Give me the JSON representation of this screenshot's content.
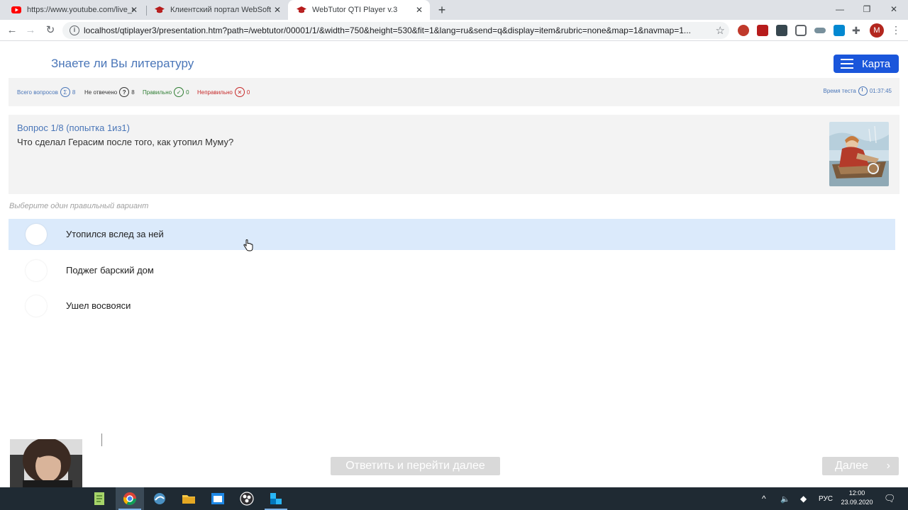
{
  "browser": {
    "tabs": [
      {
        "title": "https://www.youtube.com/live_c",
        "active": false
      },
      {
        "title": "Клиентский портал WebSoft",
        "active": false
      },
      {
        "title": "WebTutor QTI Player v.3",
        "active": true
      }
    ],
    "url": "localhost/qtiplayer3/presentation.htm?path=/webtutor/00001/1/&width=750&height=530&fit=1&lang=ru&send=q&display=item&rubric=none&map=1&navmap=1...",
    "profile_initial": "M"
  },
  "header": {
    "title": "Знаете ли Вы литературу",
    "map_button": "Карта"
  },
  "stats": {
    "total_label": "Всего вопросов",
    "total_value": "8",
    "unanswered_label": "Не отвечено",
    "unanswered_value": "8",
    "correct_label": "Правильно",
    "correct_value": "0",
    "wrong_label": "Неправильно",
    "wrong_value": "0",
    "timer_label": "Время теста",
    "timer_value": "01:37:45"
  },
  "question": {
    "header": "Вопрос 1/8  (попытка 1из1)",
    "text": "Что сделал Герасим после того, как утопил Муму?",
    "instruction": "Выберите один правильный вариант",
    "options": [
      {
        "label": "Утопился вслед за ней",
        "hovered": true
      },
      {
        "label": "Поджег барский дом",
        "hovered": false
      },
      {
        "label": "Ушел восвояси",
        "hovered": false
      }
    ]
  },
  "footer": {
    "answer_button": "Ответить и перейти далее",
    "next_button": "Далее"
  },
  "taskbar": {
    "language": "РУС",
    "time": "12:00",
    "date": "23.09.2020"
  },
  "colors": {
    "accent": "#4a76b8",
    "map_button": "#1a56db",
    "hover_row": "#dbeafb",
    "disabled_button": "#d9d9d9",
    "correct": "#2e7d32",
    "wrong": "#c62828"
  }
}
